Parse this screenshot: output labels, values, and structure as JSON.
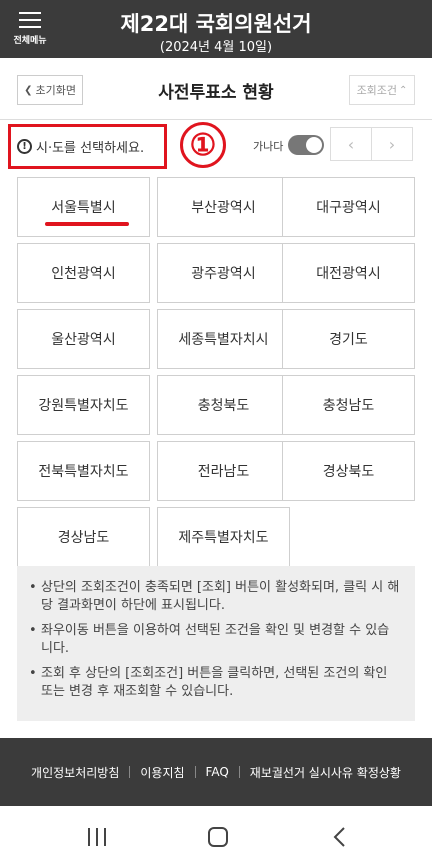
{
  "header": {
    "menu_label": "전체메뉴",
    "title": "제22대 국회의원선거",
    "subtitle": "(2024년 4월 10일)"
  },
  "subheader": {
    "home_button": "초기화면",
    "page_title": "사전투표소 현황",
    "condition_button": "조회조건"
  },
  "notice": {
    "text": "시·도를 선택하세요.",
    "step_number": "①"
  },
  "sort": {
    "label": "가나다"
  },
  "regions": [
    "서울특별시",
    "부산광역시",
    "대구광역시",
    "인천광역시",
    "광주광역시",
    "대전광역시",
    "울산광역시",
    "세종특별자치시",
    "경기도",
    "강원특별자치도",
    "충청북도",
    "충청남도",
    "전북특별자치도",
    "전라남도",
    "경상북도",
    "경상남도",
    "제주특별자치도"
  ],
  "selected_region": "서울특별시",
  "info": [
    "상단의 조회조건이 충족되면 [조회] 버튼이 활성화되며, 클릭 시 해당 결과화면이 하단에 표시됩니다.",
    "좌우이동 버튼을 이용하여 선택된 조건을 확인 및 변경할 수 있습니다.",
    "조회 후 상단의 [조회조건] 버튼을 클릭하면, 선택된 조건의 확인 또는 변경 후 재조회할 수 있습니다."
  ],
  "footer": {
    "links": [
      "개인정보처리방침",
      "이용지침",
      "FAQ",
      "재보궐선거 실시사유 확정상황"
    ]
  },
  "colors": {
    "accent_red": "#e0141e",
    "header_bg": "#3b3b3b",
    "info_bg": "#eeeeee"
  }
}
